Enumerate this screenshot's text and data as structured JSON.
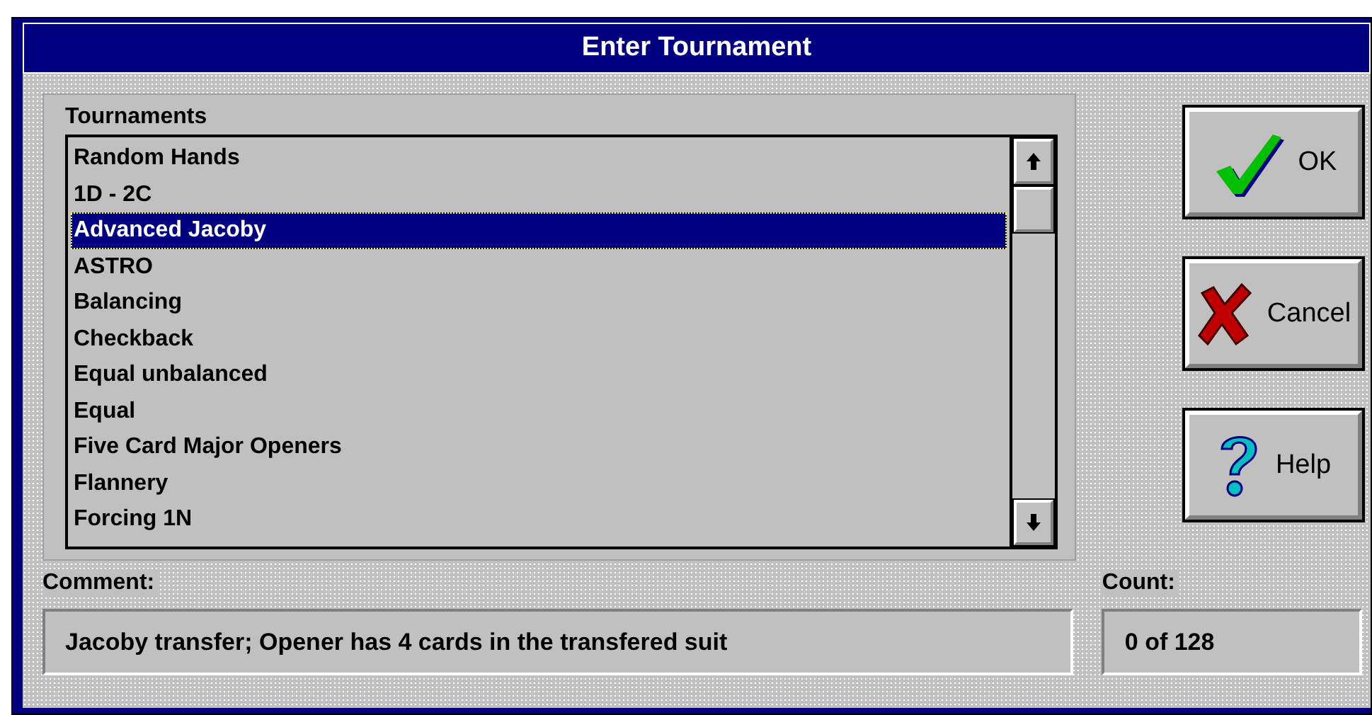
{
  "window": {
    "title": "Enter Tournament"
  },
  "tournaments": {
    "label": "Tournaments",
    "items": [
      {
        "label": "Random Hands",
        "selected": false
      },
      {
        "label": "1D - 2C",
        "selected": false
      },
      {
        "label": "Advanced Jacoby",
        "selected": true
      },
      {
        "label": "ASTRO",
        "selected": false
      },
      {
        "label": "Balancing",
        "selected": false
      },
      {
        "label": "Checkback",
        "selected": false
      },
      {
        "label": "Equal unbalanced",
        "selected": false
      },
      {
        "label": "Equal",
        "selected": false
      },
      {
        "label": "Five Card Major Openers",
        "selected": false
      },
      {
        "label": "Flannery",
        "selected": false
      },
      {
        "label": "Forcing 1N",
        "selected": false
      }
    ]
  },
  "buttons": [
    {
      "kind": "ok",
      "label": "OK"
    },
    {
      "kind": "cancel",
      "label": "Cancel"
    },
    {
      "kind": "help",
      "label": "Help"
    }
  ],
  "comment": {
    "label": "Comment:",
    "value": "Jacoby transfer; Opener has 4 cards in the transfered suit"
  },
  "count": {
    "label": "Count:",
    "value": "0 of 128"
  }
}
